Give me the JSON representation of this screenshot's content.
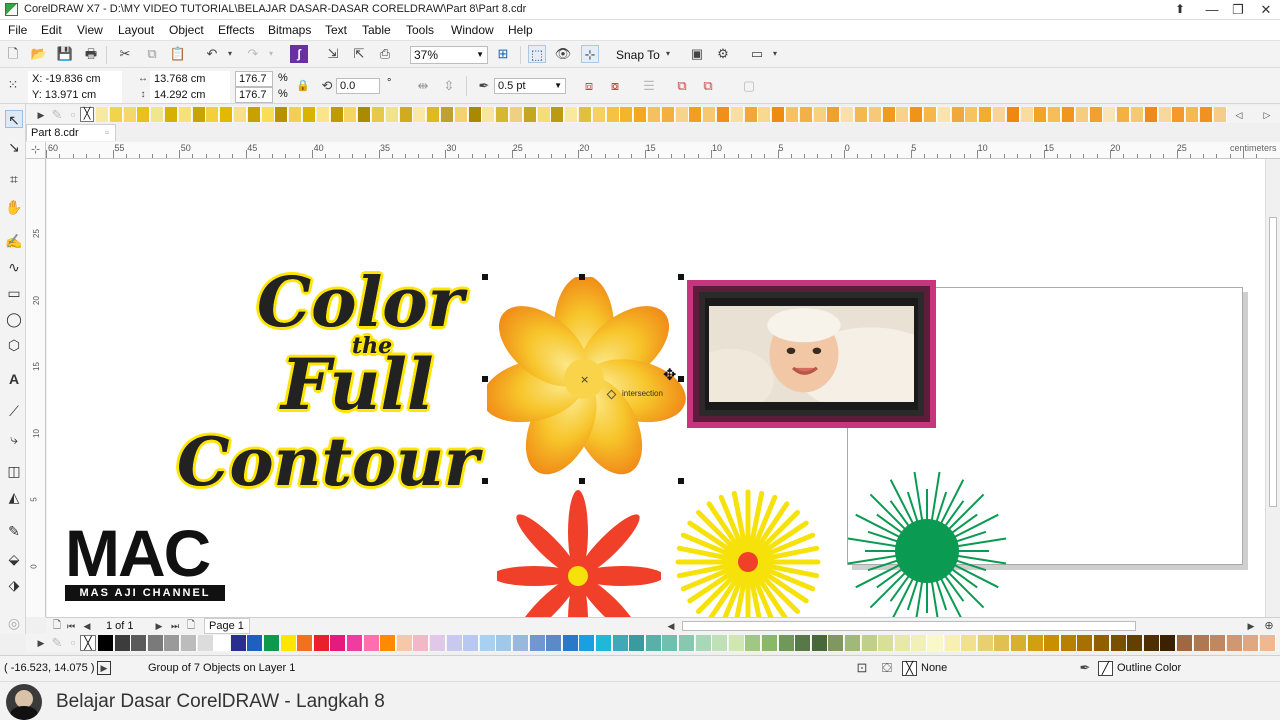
{
  "window": {
    "title": "CorelDRAW X7 - D:\\MY VIDEO TUTORIAL\\BELAJAR DASAR-DASAR CORELDRAW\\Part 8\\Part 8.cdr",
    "controls": [
      "minimize",
      "restore",
      "close"
    ]
  },
  "menu": [
    "File",
    "Edit",
    "View",
    "Layout",
    "Object",
    "Effects",
    "Bitmaps",
    "Text",
    "Table",
    "Tools",
    "Window",
    "Help"
  ],
  "toolbar": {
    "zoom": "37%",
    "snap_to": "Snap To"
  },
  "property_bar": {
    "x": "X: -19.836 cm",
    "y": "Y: 13.971 cm",
    "width": "13.768 cm",
    "height": "14.292 cm",
    "scale_x": "176.7",
    "scale_y": "176.7",
    "percent": "%",
    "rotation": "0.0",
    "degree": "°",
    "outline_width": "0.5 pt"
  },
  "document_tab": "Part 8.cdr",
  "ruler": {
    "unit": "centimeters",
    "h_ticks": [
      "60",
      "55",
      "50",
      "45",
      "40",
      "35",
      "30",
      "25",
      "20",
      "15",
      "10",
      "5",
      "0",
      "5",
      "10",
      "15",
      "20",
      "25"
    ],
    "v_ticks": [
      "25",
      "20",
      "15",
      "10",
      "5",
      "0"
    ]
  },
  "canvas": {
    "contour_text": [
      "Color",
      "the",
      "Full",
      "Contour"
    ],
    "intersection_label": "intersection",
    "logo": {
      "big": "MAC",
      "small": "MAS AJI CHANNEL"
    }
  },
  "page_nav": {
    "page_count": "1 of 1",
    "page_tab": "Page 1"
  },
  "status": {
    "coordinates": "( -16.523, 14.075 )",
    "selection": "Group of 7 Objects on Layer 1",
    "fill": "None",
    "outline": "Outline Color"
  },
  "caption": "Belajar Dasar CorelDRAW - Langkah 8",
  "colors": {
    "accent_frame": "#c8357f",
    "flower_red": "#f0402a",
    "flower_yellow": "#f6e20a",
    "flower_green": "#0b9a52"
  }
}
